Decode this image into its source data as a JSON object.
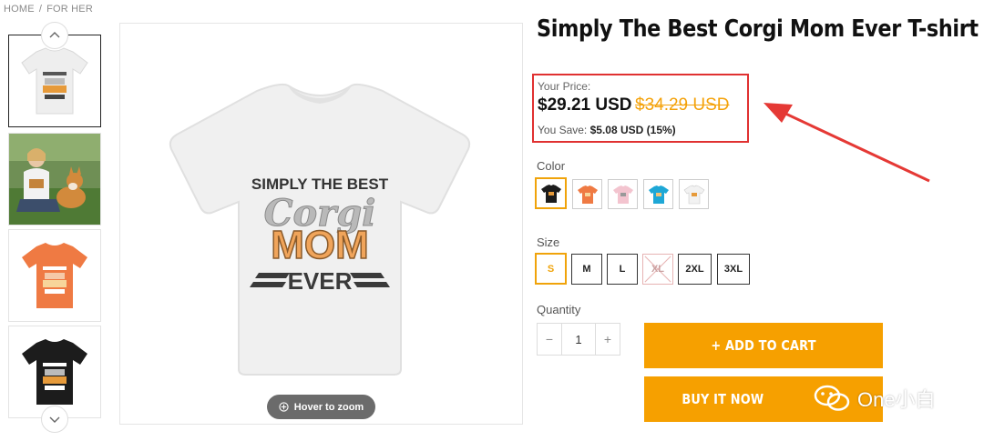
{
  "breadcrumb": {
    "home": "HOME",
    "separator": "/",
    "current": "FOR HER"
  },
  "product": {
    "title": "Simply The Best Corgi Mom Ever T-shirt",
    "price_label": "Your Price:",
    "price_now": "$29.21 USD",
    "price_old": "$34.29 USD",
    "save_label": "You Save:",
    "save_value": "$5.08 USD (15%)"
  },
  "gallery": {
    "zoom_label": "Hover to zoom",
    "print_lines": [
      "SIMPLY THE BEST",
      "Corgi",
      "MOM",
      "EVER"
    ],
    "thumbnails": [
      "white-shirt",
      "model-with-corgi",
      "orange-shirt",
      "black-shirt"
    ]
  },
  "color": {
    "label": "Color",
    "options": [
      {
        "name": "black",
        "hex": "#1c1c1c",
        "selected": true
      },
      {
        "name": "orange",
        "hex": "#ef7a43",
        "selected": false
      },
      {
        "name": "pink",
        "hex": "#f3c4cf",
        "selected": false
      },
      {
        "name": "blue",
        "hex": "#1ea7d6",
        "selected": false
      },
      {
        "name": "white",
        "hex": "#f4f4f4",
        "selected": false
      }
    ]
  },
  "size": {
    "label": "Size",
    "options": [
      {
        "label": "S",
        "state": "selected"
      },
      {
        "label": "M",
        "state": "default"
      },
      {
        "label": "L",
        "state": "default"
      },
      {
        "label": "XL",
        "state": "disabled"
      },
      {
        "label": "2XL",
        "state": "default"
      },
      {
        "label": "3XL",
        "state": "default"
      }
    ]
  },
  "quantity": {
    "label": "Quantity",
    "value": "1",
    "minus": "−",
    "plus": "+"
  },
  "actions": {
    "add_to_cart": "+ ADD TO CART",
    "buy_now": "BUY IT NOW"
  },
  "watermark": {
    "text": "One小白"
  },
  "colors": {
    "accent": "#f6a000",
    "highlight_box": "#e03131"
  }
}
